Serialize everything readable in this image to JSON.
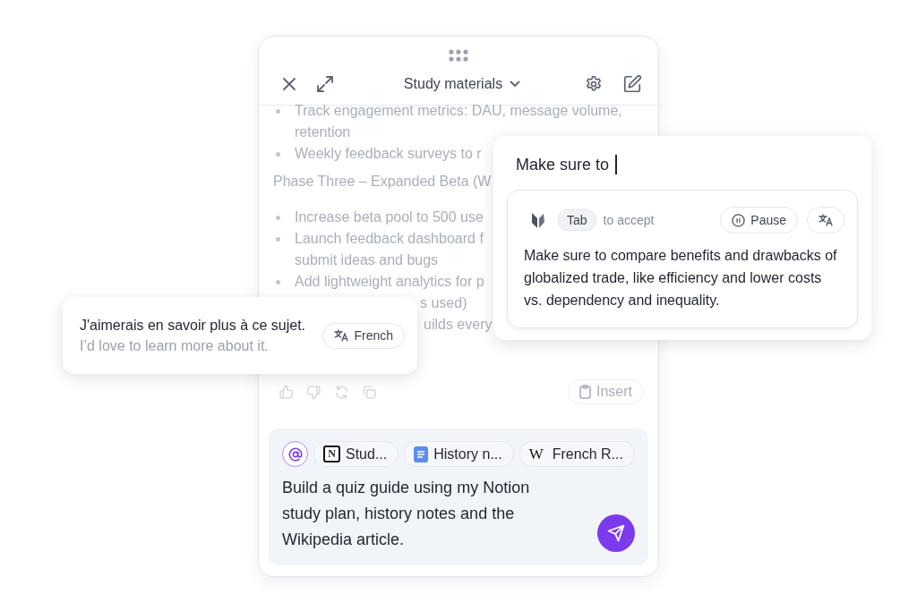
{
  "panel": {
    "title": "Study materials"
  },
  "document": [
    {
      "kind": "bullet",
      "text": "Track engagement metrics: DAU, message volume,"
    },
    {
      "kind": "continuation",
      "text": "retention"
    },
    {
      "kind": "bullet",
      "text": "Weekly feedback surveys to r"
    },
    {
      "kind": "heading",
      "text": "Phase Three – Expanded Beta (W"
    },
    {
      "kind": "bullet",
      "text": "Increase beta pool to 500 use"
    },
    {
      "kind": "bullet",
      "text": "Launch feedback dashboard f"
    },
    {
      "kind": "continuation",
      "text": "submit ideas and bugs"
    },
    {
      "kind": "bullet",
      "text": "Add lightweight analytics for p"
    },
    {
      "kind": "fragment",
      "text": "s used)"
    },
    {
      "kind": "fragment",
      "text": "uilds every"
    }
  ],
  "insert_button": {
    "label": "Insert",
    "disabled": true
  },
  "composer": {
    "chips": [
      {
        "kind": "notion",
        "glyph": "N",
        "label": "Stud..."
      },
      {
        "kind": "doc",
        "label": "History n..."
      },
      {
        "kind": "wiki",
        "glyph": "W",
        "label": "French R..."
      }
    ],
    "value": "Build a quiz guide using my Notion study plan, history notes and the Wikipedia article."
  },
  "autocomplete": {
    "typed": "Make sure to",
    "key": "Tab",
    "hint": "to accept",
    "pause_label": "Pause",
    "suggestion": "Make sure to compare benefits and drawbacks of globalized trade, like efficiency and lower costs vs. dependency and inequality."
  },
  "translation": {
    "original": "J'aimerais en savoir plus à ce sujet.",
    "translated": "I’d love to learn more about it.",
    "language": "French"
  }
}
